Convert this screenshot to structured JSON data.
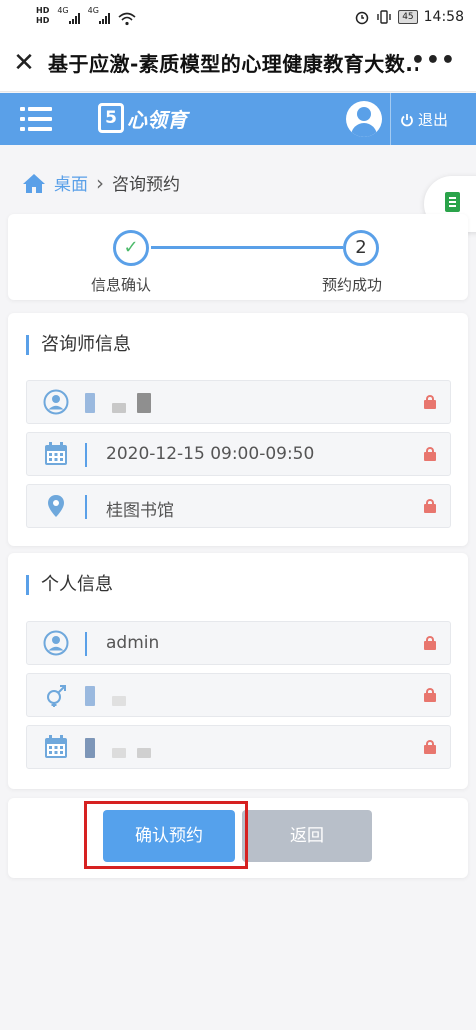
{
  "status_bar": {
    "time": "14:58",
    "battery": "45",
    "network_1": "4G",
    "network_2": "4G",
    "sim_labels": [
      "HD",
      "HD"
    ]
  },
  "title_bar": {
    "close_glyph": "✕",
    "title": "基于应激-素质模型的心理健康教育大数...",
    "more_glyph": "•••"
  },
  "app_bar": {
    "logo_text": "心领育",
    "logout_label": "退出"
  },
  "breadcrumb": {
    "home": "桌面",
    "separator": "›",
    "current": "咨询预约"
  },
  "steps": [
    {
      "label": "信息确认",
      "marker": "✓",
      "status": "done"
    },
    {
      "label": "预约成功",
      "marker": "2",
      "status": "pending"
    }
  ],
  "counselor_section": {
    "title": "咨询师信息",
    "fields": [
      {
        "icon": "user-circle-icon",
        "value": ""
      },
      {
        "icon": "calendar-icon",
        "value": "2020-12-15 09:00-09:50"
      },
      {
        "icon": "location-pin-icon",
        "value": "桂图书馆"
      }
    ]
  },
  "personal_section": {
    "title": "个人信息",
    "fields": [
      {
        "icon": "user-circle-icon",
        "value": "admin"
      },
      {
        "icon": "gender-icon",
        "value": ""
      },
      {
        "icon": "calendar-icon",
        "value": ""
      }
    ]
  },
  "actions": {
    "confirm_label": "确认预约",
    "back_label": "返回"
  },
  "colors": {
    "primary": "#5aa0e8",
    "success": "#4cba6a",
    "lock": "#e8766e",
    "highlight": "#d62121"
  }
}
